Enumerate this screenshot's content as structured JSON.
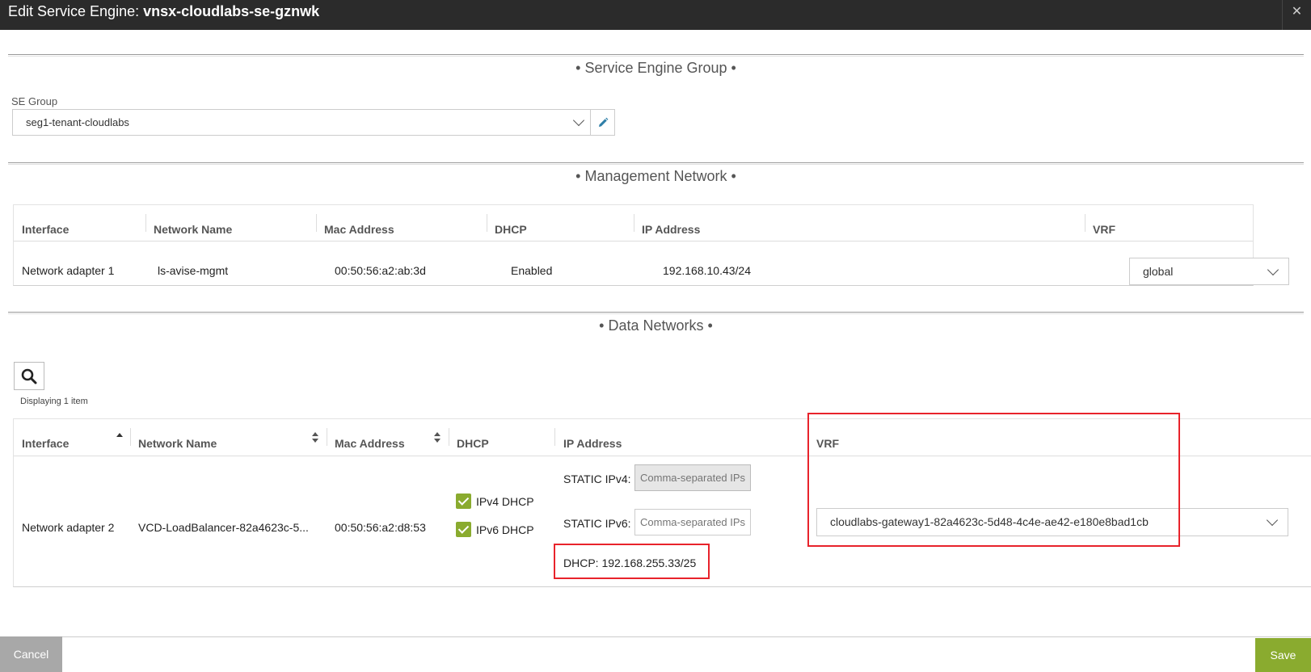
{
  "dialog": {
    "title_prefix": "Edit Service Engine: ",
    "title_name": "vnsx-cloudlabs-se-gznwk",
    "close_glyph": "✕"
  },
  "se_group_section": {
    "heading": "• Service Engine Group •",
    "field_label": "SE Group",
    "selected": "seg1-tenant-cloudlabs"
  },
  "management_section": {
    "heading": "• Management Network •",
    "columns": [
      "Interface",
      "Network Name",
      "Mac Address",
      "DHCP",
      "IP Address",
      "VRF"
    ],
    "row": {
      "interface": "Network adapter 1",
      "network_name": "ls-avise-mgmt",
      "mac": "00:50:56:a2:ab:3d",
      "dhcp": "Enabled",
      "ip": "192.168.10.43/24",
      "vrf": "global"
    }
  },
  "data_section": {
    "heading": "• Data Networks •",
    "displaying": "Displaying 1 item",
    "columns": [
      "Interface",
      "Network Name",
      "Mac Address",
      "DHCP",
      "IP Address",
      "VRF"
    ],
    "row": {
      "interface": "Network adapter 2",
      "network_name": "VCD-LoadBalancer-82a4623c-5...",
      "mac": "00:50:56:a2:d8:53",
      "ipv4_dhcp_label": "IPv4 DHCP",
      "ipv6_dhcp_label": "IPv6 DHCP",
      "static_ipv4_label": "STATIC IPv4:",
      "static_ipv6_label": "STATIC IPv6:",
      "static_placeholder": "Comma-separated IPs",
      "dhcp_ip": "DHCP: 192.168.255.33/25",
      "vrf": "cloudlabs-gateway1-82a4623c-5d48-4c4e-ae42-e180e8bad1cb"
    }
  },
  "footer": {
    "cancel_label": "Cancel",
    "save_label": "Save"
  },
  "colors": {
    "accent_green": "#8aab2f",
    "highlight_red": "#e8232b",
    "titlebar_bg": "#2b2b2b"
  }
}
